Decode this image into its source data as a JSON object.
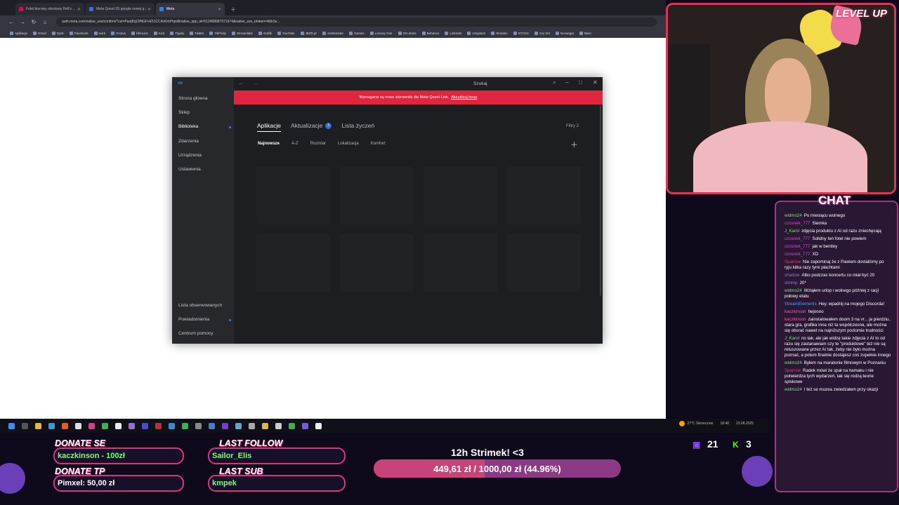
{
  "browser": {
    "tabs": [
      {
        "label": "Fotel biurowy obrotowy Hell's ..."
      },
      {
        "label": "Meta Quest 3S google nowej g..."
      },
      {
        "label": "Meta"
      }
    ],
    "url": "auth.meta.com/native_sso/confirm/?csi=PanjBcjOfNGFvE51CC4cKmPhpsBnative_app_id=512468987071674&native_sso_etoken=AbkSv..."
  },
  "bookmarks": [
    "Aplikacje",
    "Gmail",
    "Dysk",
    "Facebook",
    "work",
    "Oculus",
    "bhinLive",
    "Kick",
    "Tippily",
    "Twitter",
    "TikFinity",
    "Streamlabs",
    "Grafik",
    "YouTube",
    "JBZD.pl",
    "JoeMonster",
    "Games",
    "Losowy Gier",
    "GG.deals",
    "Behance",
    "LinkedIn",
    "Unsplash",
    "Shinden",
    "STOCK",
    "Gry tmt",
    "Norwegia",
    "Mem"
  ],
  "meta_app": {
    "sidebar": {
      "items": [
        "Strona główna",
        "Sklep",
        "Biblioteka",
        "Zdarzenia",
        "Urządzenia",
        "Ustawienia"
      ],
      "bottom_items": [
        "Lista obserwowanych",
        "Powiadomienia",
        "Centrum pomocy"
      ]
    },
    "search_label": "Szukaj",
    "banner": {
      "text": "Wymagane są nowe sterowniki dla Meta Quest Link.",
      "link": "Aktualizuj teraz"
    },
    "tabs": [
      {
        "label": "Aplikacje"
      },
      {
        "label": "Aktualizacje",
        "badge": "1"
      },
      {
        "label": "Lista życzeń"
      }
    ],
    "filters": "Filtry 2",
    "sorts": [
      "Najnowsze",
      "A-Z",
      "Rozmiar",
      "Lokalizacja",
      "Komfort"
    ],
    "colors": {
      "accent": "#e0263f",
      "blue": "#2e6fe0"
    }
  },
  "taskbar": {
    "weather": "27°C Słonecznie",
    "time": "18:48",
    "date": "23.08.2025"
  },
  "chat": {
    "title": "CHAT",
    "messages": [
      {
        "user": "widmo24",
        "text": "Po miesiącu wolnego",
        "color": "#7fe07a"
      },
      {
        "user": "czosnek_777",
        "text": "Siemka",
        "color": "#d24fd0"
      },
      {
        "user": "J_Karol",
        "text": "zdjęcia produktu z AI od razu zniechęcają",
        "color": "#7fe07a"
      },
      {
        "user": "czosnek_777",
        "text": "Solidny ten fotel nie powiem",
        "color": "#d24fd0"
      },
      {
        "user": "czosnek_777",
        "text": "jak w bentley",
        "color": "#d24fd0"
      },
      {
        "user": "czosnek_777",
        "text": "XD",
        "color": "#d24fd0"
      },
      {
        "user": "Sparrow",
        "text": "Nie zapominaj że z Pawiem dostaliśmy po ryju kilka razy tymi płachtami",
        "color": "#e0406a"
      },
      {
        "user": "shadow",
        "text": "Albo podczas koncertu co miał być 20",
        "color": "#8a7de0"
      },
      {
        "user": "shrimp",
        "text": "20*",
        "color": "#8a7de0"
      },
      {
        "user": "widmo24",
        "text": "Wziąłem urlop i wolnego później z racji połowy etatu",
        "color": "#7fe07a"
      },
      {
        "user": "StreamElements",
        "text": "Hey, wpadnij na mojego Discorda!",
        "color": "#4aa3ff"
      },
      {
        "user": "kaczkinson",
        "text": "hejoooo",
        "color": "#ff5aa0"
      },
      {
        "user": "kaczkinson",
        "text": "zainstalowałem doom 3 na vr... ja pierdziu.. stara gra, grafika inna niż ta współczesna, ale można się obsrać nawet na najniższym poziomie trudności",
        "color": "#ff5aa0"
      },
      {
        "user": "J_Karol",
        "text": "no tak, ale jak widzę takie zdjęcia z AI to od razu się zastanawiam czy te \"produktowe\" też nie są retuszowane przez AI tak, żeby nie było można poznać, a potem finalnie dostajesz coś zupełnie innego",
        "color": "#7fe07a"
      },
      {
        "user": "widmo24",
        "text": "Byłem na maratonie filmowym w Poznaniu",
        "color": "#7fe07a"
      },
      {
        "user": "Sparrow",
        "text": "Radek mówi że spał na hamaku i nie potwierdza tych wydarzeń, tak się rodzą teorie spiskowe",
        "color": "#e0406a"
      },
      {
        "user": "widmo24",
        "text": "I też se muzea zwiedzałem przy okazji",
        "color": "#7fe07a"
      }
    ]
  },
  "overlays": {
    "donate_se": {
      "label": "DONATE SE",
      "value": "kaczkinson - 100zł"
    },
    "donate_tp": {
      "label": "DONATE TP",
      "value": "Pimxel: 50,00 zł"
    },
    "last_follow": {
      "label": "LAST FOLLOW",
      "value": "Sailor_Elis"
    },
    "last_sub": {
      "label": "LAST SUB",
      "value": "kmpek"
    },
    "goal": {
      "title": "12h Strimek! <3",
      "text": "449,61 zł / 1000,00 zł (44.96%)",
      "progress": 0.4496
    },
    "twitch_count": "21",
    "kick_count": "3"
  }
}
